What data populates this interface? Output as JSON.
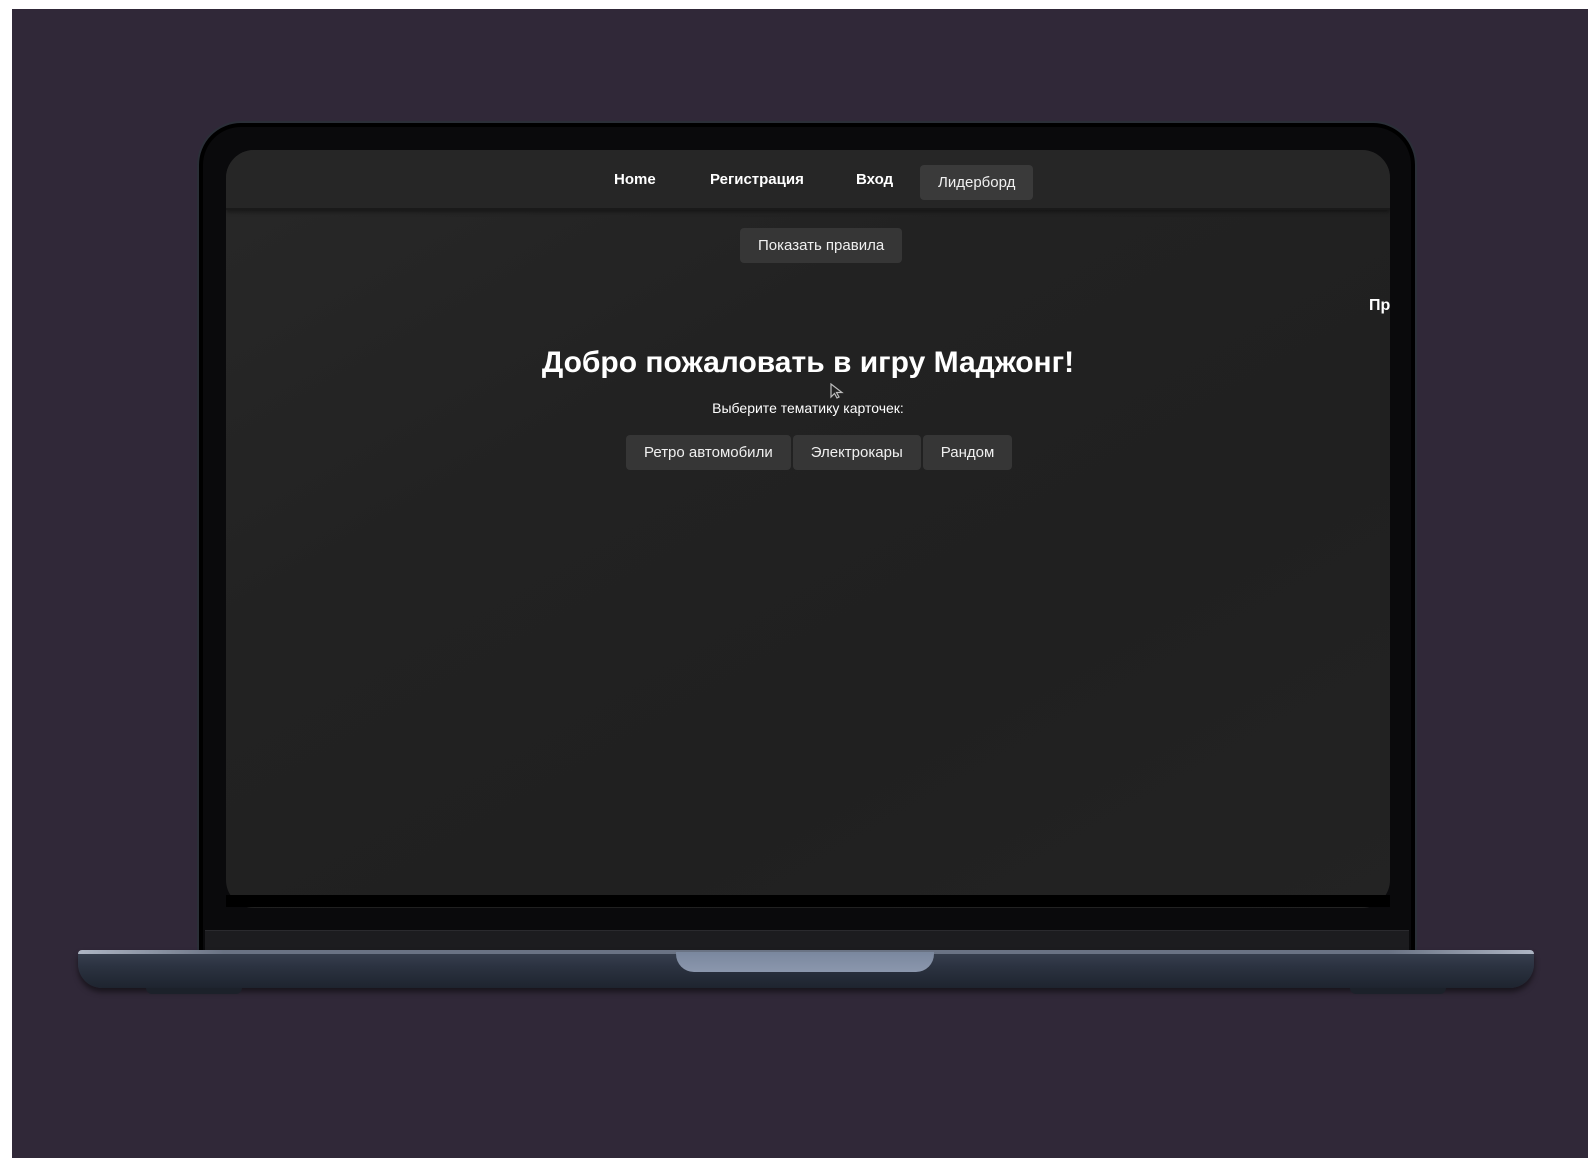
{
  "nav": {
    "home": "Home",
    "register": "Регистрация",
    "login": "Вход",
    "leaderboard": "Лидерборд"
  },
  "rules_button": "Показать правила",
  "side_text": "Пр",
  "welcome_title": "Добро пожаловать в игру Маджонг!",
  "theme_prompt": "Выберите тематику карточек:",
  "themes": [
    "Ретро автомобили",
    "Электрокары",
    "Рандом"
  ],
  "colors": {
    "backdrop": "#302838",
    "screen_bg": "#222222",
    "navbar_bg": "#262626",
    "button_bg": "#363636",
    "text": "#ffffff"
  }
}
